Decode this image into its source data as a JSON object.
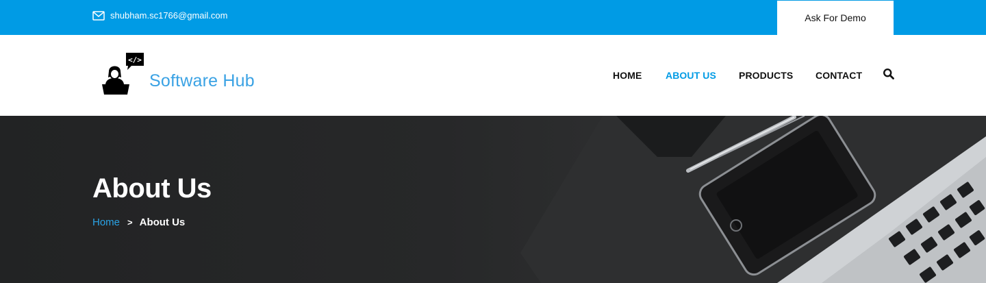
{
  "topbar": {
    "email": "shubham.sc1766@gmail.com",
    "email_icon": "envelope-icon",
    "demo_label": "Ask For Demo"
  },
  "header": {
    "brand": "Software Hub",
    "brand_color": "#3aa2e4",
    "nav": [
      {
        "label": "HOME",
        "active": false
      },
      {
        "label": "ABOUT US",
        "active": true
      },
      {
        "label": "PRODUCTS",
        "active": false
      },
      {
        "label": "CONTACT",
        "active": false
      }
    ],
    "search_icon": "search-icon"
  },
  "hero": {
    "title": "About Us",
    "breadcrumb": {
      "home": "Home",
      "separator": ">",
      "current": "About Us"
    }
  },
  "colors": {
    "accent": "#009be5",
    "hero_bg": "#262728",
    "text_dark": "#111111"
  }
}
